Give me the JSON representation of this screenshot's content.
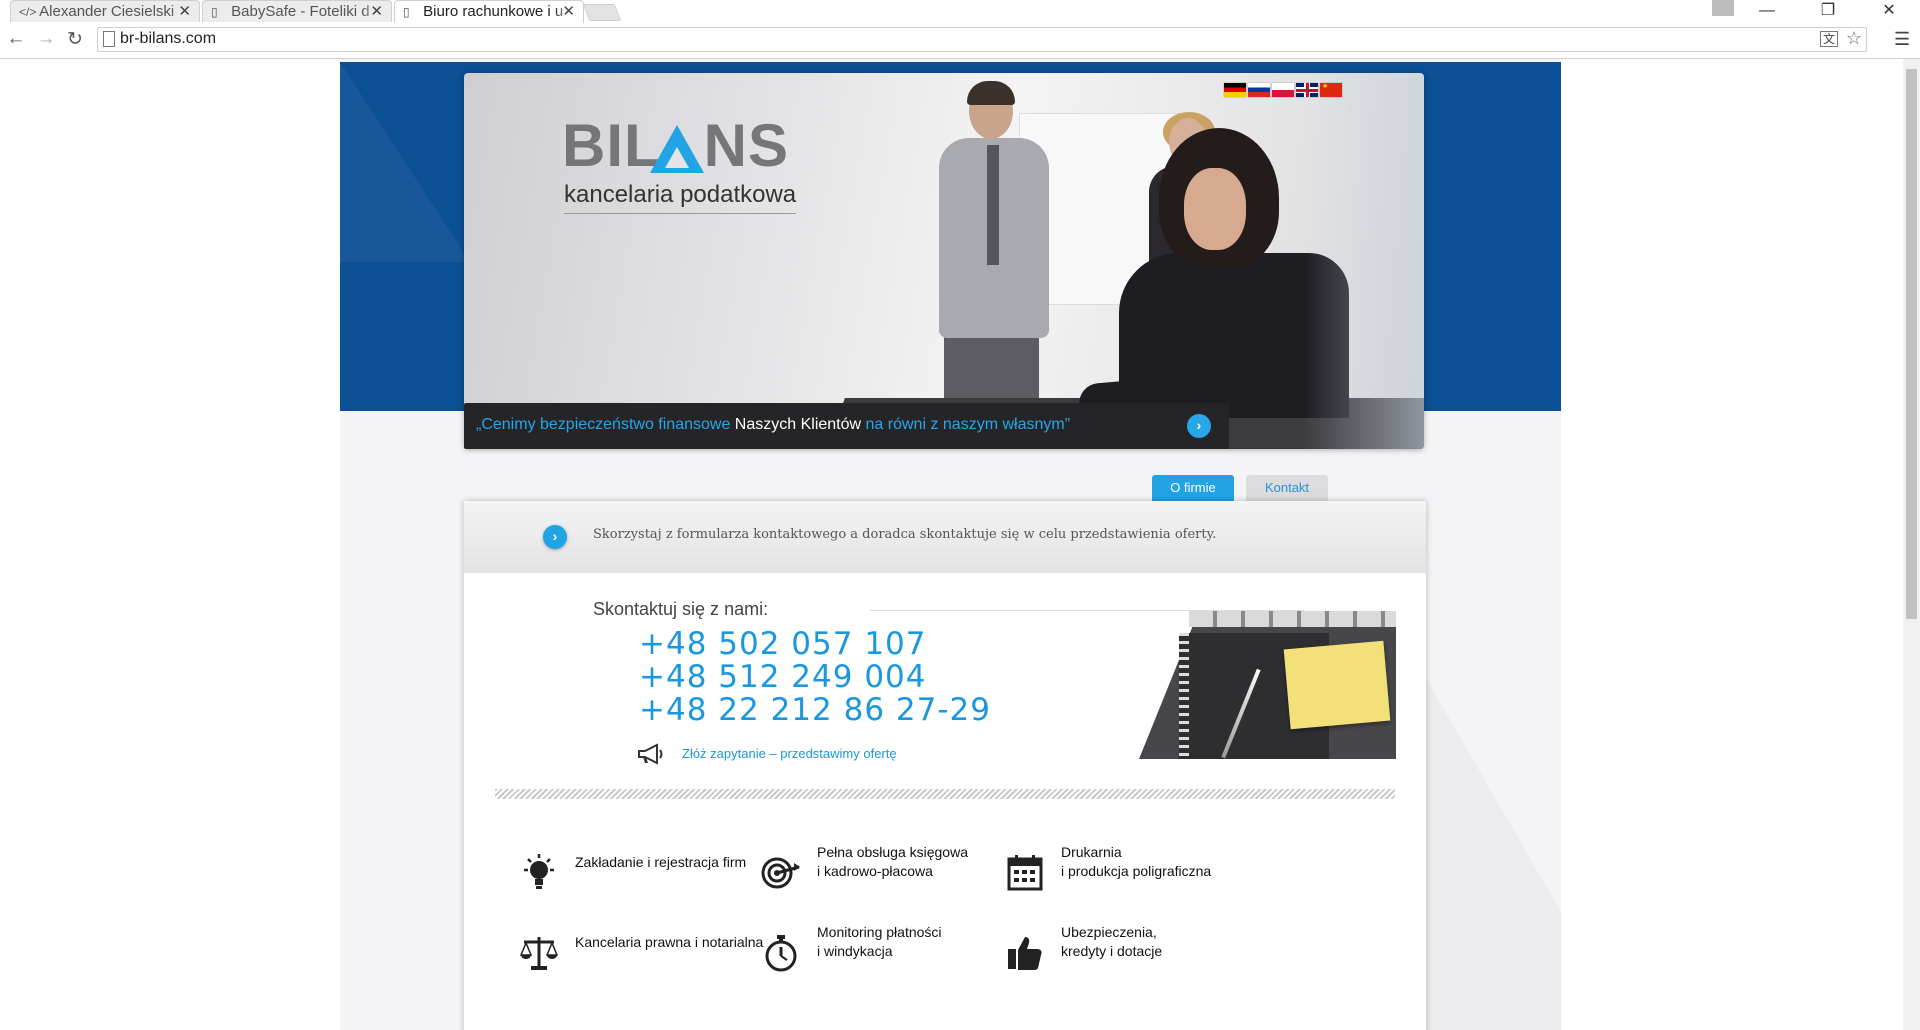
{
  "browser": {
    "tabs": [
      {
        "label": "Alexander Ciesielski",
        "icon": "code-icon"
      },
      {
        "label": "BabySafe - Foteliki d",
        "icon": "page-icon"
      },
      {
        "label": "Biuro rachunkowe i u",
        "icon": "page-icon"
      }
    ],
    "url": "br-bilans.com",
    "window_controls": {
      "minimize": "—",
      "restore": "❐",
      "close": "✕"
    }
  },
  "site": {
    "logo": {
      "name_left": "BIL",
      "name_right": "NS",
      "tagline": "kancelaria podatkowa"
    },
    "flags": [
      "de",
      "ru",
      "pl",
      "gb",
      "cn"
    ],
    "quote": {
      "part1": "„Cenimy bezpieczeństwo finansowe ",
      "part2": "Naszych Klientów",
      "part3": " na równi z naszym własnym”"
    },
    "nav": {
      "about": "O firmie",
      "contact": "Kontakt"
    },
    "tip": "Skorzystaj z formularza kontaktowego a doradca skontaktuje się w celu przedstawienia oferty.",
    "contact": {
      "heading": "Skontaktuj się z nami:",
      "phones": [
        "+48 502 057 107",
        "+48 512 249 004",
        "+48 22 212 86 27-29"
      ],
      "inquiry": "Złóż zapytanie – przedstawimy  ofertę"
    },
    "services": [
      {
        "line1": "Zakładanie i rejestracja firm",
        "line2": "",
        "icon": "lightbulb-icon"
      },
      {
        "line1": "Pełna obsługa księgowa",
        "line2": "i kadrowo-płacowa",
        "icon": "target-icon"
      },
      {
        "line1": "Drukarnia",
        "line2": "i produkcja poligraficzna",
        "icon": "calendar-icon"
      },
      {
        "line1": "Kancelaria prawna i notarialna",
        "line2": "",
        "icon": "scales-icon"
      },
      {
        "line1": "Monitoring płatności",
        "line2": "i windykacja",
        "icon": "stopwatch-icon"
      },
      {
        "line1": "Ubezpieczenia,",
        "line2": "kredyty i dotacje",
        "icon": "thumbs-up-icon"
      }
    ],
    "colors": {
      "brand_blue": "#0b4f95",
      "accent": "#22a3e4",
      "phone": "#1b97df"
    }
  }
}
